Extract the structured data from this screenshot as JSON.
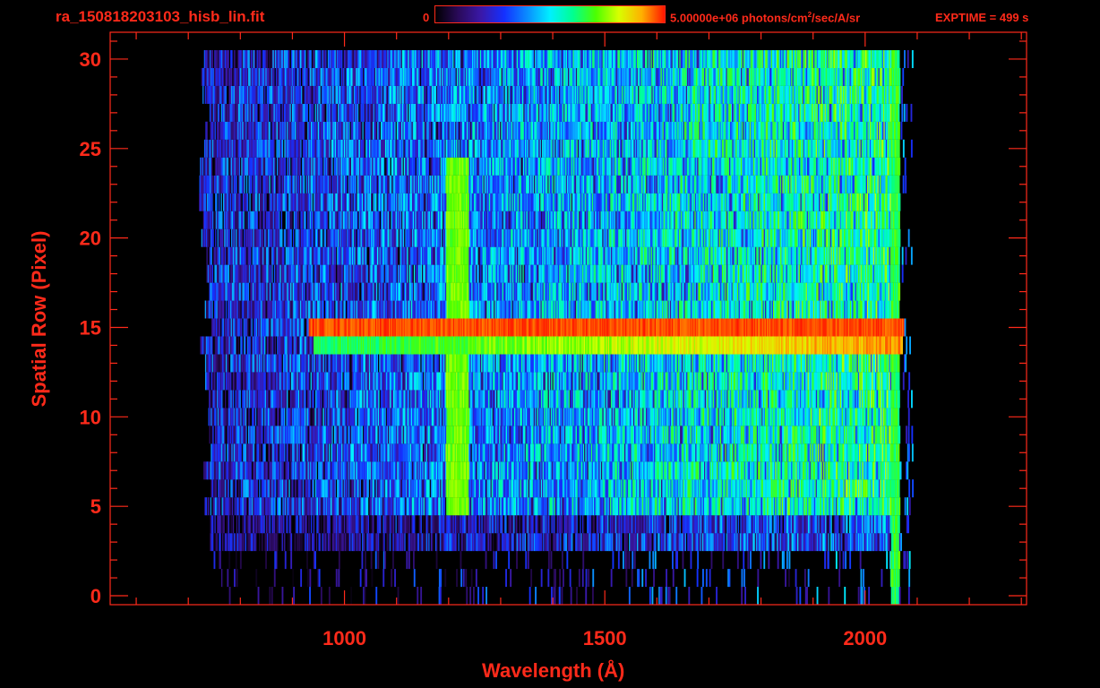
{
  "header": {
    "title": "ra_150818203103_hisb_lin.fit",
    "colorbar_min": "0",
    "colorbar_max_value": "5.00000e+06 photons/cm",
    "colorbar_max_exp": "2",
    "colorbar_max_unit": "/sec/A/sr",
    "exptime": "EXPTIME = 499 s"
  },
  "colors": {
    "foreground": "#ff2a1a",
    "background": "#000000",
    "colormap": [
      "#000000",
      "#2a0a5a",
      "#3a18a8",
      "#1430ff",
      "#0a8cff",
      "#00f0ff",
      "#00ff90",
      "#4cff00",
      "#d8ff00",
      "#ffb000",
      "#ff1500"
    ]
  },
  "chart_data": {
    "type": "heatmap",
    "title": "ra_150818203103_hisb_lin.fit",
    "xlabel": "Wavelength (Å)",
    "ylabel": "Spatial Row (Pixel)",
    "xlim": [
      550,
      2310
    ],
    "ylim": [
      -0.5,
      31.5
    ],
    "x_ticks": [
      1000,
      1500,
      2000
    ],
    "y_ticks": [
      0,
      5,
      10,
      15,
      20,
      25,
      30
    ],
    "colorbar": {
      "min": 0,
      "max": 5000000,
      "unit": "photons/cm^2/sec/A/sr",
      "colormap": "rainbow"
    },
    "data_extent": {
      "x": [
        720,
        2060
      ],
      "rows": [
        0,
        30
      ]
    },
    "features": [
      {
        "name": "bright row",
        "row": 15,
        "x_start": 930,
        "x_end": 2060,
        "level": 1.0
      },
      {
        "name": "adjacent row",
        "row": 14,
        "x_start": 940,
        "x_end": 2070,
        "level": 0.75
      },
      {
        "name": "emission line",
        "x": 1216,
        "rows": [
          5,
          24
        ],
        "level": 0.72
      },
      {
        "name": "red edge",
        "x": 2060,
        "rows": [
          0,
          30
        ],
        "level": 0.65
      }
    ]
  }
}
